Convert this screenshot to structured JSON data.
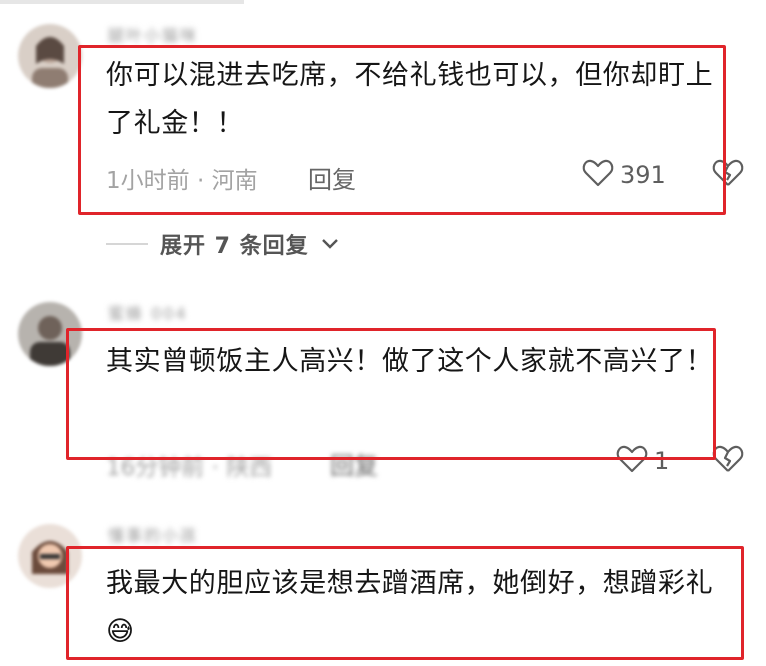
{
  "comments": [
    {
      "username": "腿叶小猫咪",
      "text": "你可以混进去吃席，不给礼钱也可以，但你却盯上了礼金！！",
      "time_location": "1小时前 · 河南",
      "reply_label": "回复",
      "likes": "391"
    },
    {
      "username": "蜜蜂 004",
      "text": "其实曾顿饭主人高兴！做了这个人家就不高兴了！",
      "time_location": "16分钟前 · 陕西",
      "reply_label": "回复",
      "likes": "1"
    },
    {
      "username": "懂事的小孩",
      "text": "我最大的胆应该是想去蹭酒席，她倒好，想蹭彩礼",
      "emoji": "😅"
    }
  ],
  "expand_replies": {
    "label": "展开 7 条回复"
  },
  "icons": {
    "heart": "heart-outline-icon",
    "dislike": "broken-heart-icon",
    "chevron": "chevron-down-icon"
  },
  "colors": {
    "highlight_box": "#e0242a",
    "meta": "#a3a3a3",
    "text": "#161616"
  }
}
